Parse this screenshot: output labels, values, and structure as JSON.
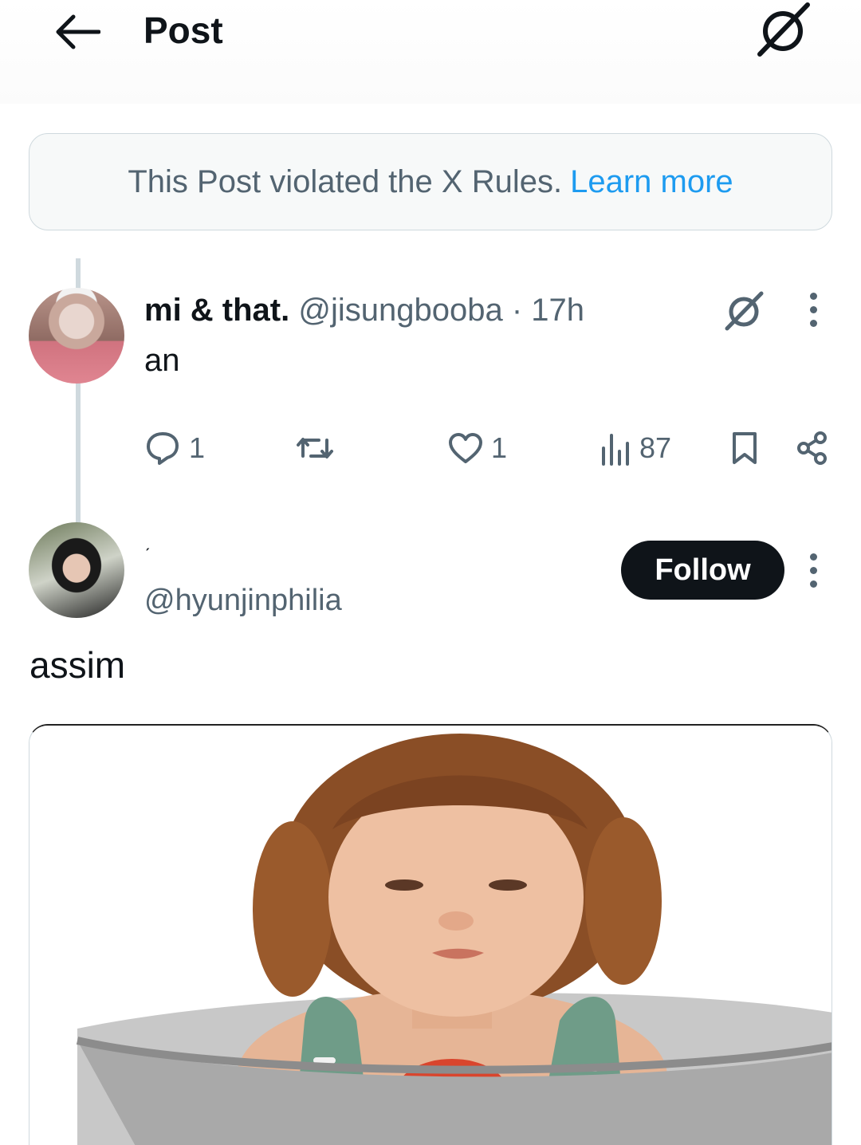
{
  "header": {
    "title": "Post",
    "back_icon": "arrow-left-icon",
    "grok_icon": "grok-icon"
  },
  "notice": {
    "text": "This Post violated the X Rules.",
    "link": "Learn more"
  },
  "tweet": {
    "name": "mi & that.",
    "handle": "@jisungbooba",
    "separator": "·",
    "time": "17h",
    "text": "an",
    "replies": "1",
    "likes": "1",
    "views": "87"
  },
  "reply": {
    "name": "ˏ",
    "handle": "@hyunjinphilia",
    "follow_label": "Follow",
    "text": "assim"
  },
  "colors": {
    "text_primary": "#0f1419",
    "text_secondary": "#536471",
    "link": "#1d9bf0",
    "border": "#cfd9de"
  }
}
